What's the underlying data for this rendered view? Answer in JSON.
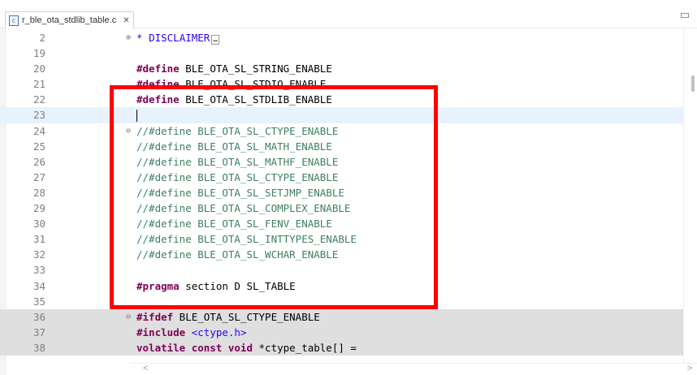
{
  "tab": {
    "label": "r_ble_ota_stdlib_table.c",
    "icon": "c-file-icon",
    "close": "✕"
  },
  "colors": {
    "keyword": "#7f0055",
    "comment": "#3f7f5f",
    "string": "#2a00ff",
    "highlight_box": "#ff0000"
  },
  "editor": {
    "lines": [
      {
        "num": "2",
        "collapsed": true,
        "fold": "⊕",
        "prefix": "* ",
        "text": "DISCLAIMER",
        "collapsed_marker": "…"
      },
      {
        "num": "19",
        "text": ""
      },
      {
        "num": "20",
        "kw": "#define",
        "text": " BLE_OTA_SL_STRING_ENABLE"
      },
      {
        "num": "21",
        "kw": "#define",
        "text": " BLE_OTA_SL_STDIO_ENABLE"
      },
      {
        "num": "22",
        "kw": "#define",
        "text": " BLE_OTA_SL_STDLIB_ENABLE"
      },
      {
        "num": "23",
        "text": "",
        "current": true
      },
      {
        "num": "24",
        "fold": "⊖",
        "comment": "//#define BLE_OTA_SL_CTYPE_ENABLE"
      },
      {
        "num": "25",
        "comment": "//#define BLE_OTA_SL_MATH_ENABLE"
      },
      {
        "num": "26",
        "comment": "//#define BLE_OTA_SL_MATHF_ENABLE"
      },
      {
        "num": "27",
        "comment": "//#define BLE_OTA_SL_CTYPE_ENABLE"
      },
      {
        "num": "28",
        "comment": "//#define BLE_OTA_SL_SETJMP_ENABLE"
      },
      {
        "num": "29",
        "comment": "//#define BLE_OTA_SL_COMPLEX_ENABLE"
      },
      {
        "num": "30",
        "comment": "//#define BLE_OTA_SL_FENV_ENABLE"
      },
      {
        "num": "31",
        "comment": "//#define BLE_OTA_SL_INTTYPES_ENABLE"
      },
      {
        "num": "32",
        "comment": "//#define BLE_OTA_SL_WCHAR_ENABLE"
      },
      {
        "num": "33",
        "text": ""
      },
      {
        "num": "34",
        "kw": "#pragma",
        "text": " section D SL_TABLE"
      },
      {
        "num": "35",
        "text": ""
      },
      {
        "num": "36",
        "fold": "⊖",
        "kw": "#ifdef",
        "text": " BLE_OTA_SL_CTYPE_ENABLE",
        "grey": true
      },
      {
        "num": "37",
        "kw": "#include",
        "str": " <ctype.h>",
        "grey": true
      },
      {
        "num": "38",
        "kw": "volatile const void",
        "text": " *ctype_table[] =",
        "grey": true
      }
    ]
  },
  "scrollbars": {
    "left_arrow": "<",
    "right_arrow": ">"
  }
}
